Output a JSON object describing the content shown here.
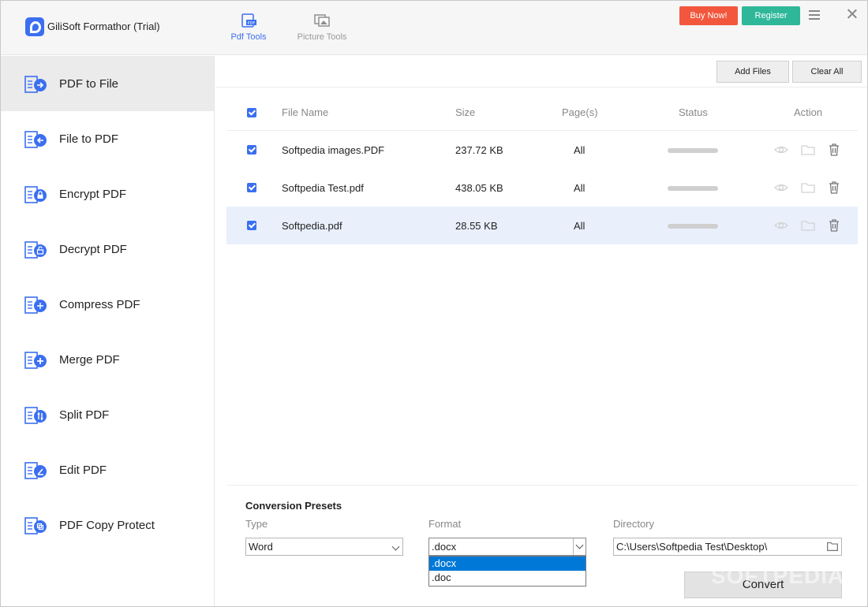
{
  "app": {
    "title": "GiliSoft Formathor (Trial)"
  },
  "header": {
    "tabs": [
      {
        "label": "Pdf Tools",
        "icon": "pdf-tools-icon"
      },
      {
        "label": "Picture Tools",
        "icon": "picture-tools-icon"
      }
    ],
    "buy_label": "Buy Now!",
    "register_label": "Register"
  },
  "colors": {
    "accent": "#3b6ff0",
    "buy": "#f2573d",
    "register": "#2fb79a",
    "selection": "#0078d7"
  },
  "sidebar": {
    "items": [
      {
        "label": "PDF to File",
        "icon": "pdf-to-file-icon",
        "active": true
      },
      {
        "label": "File to PDF",
        "icon": "file-to-pdf-icon"
      },
      {
        "label": "Encrypt PDF",
        "icon": "encrypt-pdf-icon"
      },
      {
        "label": "Decrypt PDF",
        "icon": "decrypt-pdf-icon"
      },
      {
        "label": "Compress PDF",
        "icon": "compress-pdf-icon"
      },
      {
        "label": "Merge PDF",
        "icon": "merge-pdf-icon"
      },
      {
        "label": "Split PDF",
        "icon": "split-pdf-icon"
      },
      {
        "label": "Edit PDF",
        "icon": "edit-pdf-icon"
      },
      {
        "label": "PDF Copy Protect",
        "icon": "pdf-copy-protect-icon"
      }
    ]
  },
  "toolbar": {
    "add_files": "Add Files",
    "clear_all": "Clear All"
  },
  "table": {
    "columns": [
      "File Name",
      "Size",
      "Page(s)",
      "Status",
      "Action"
    ],
    "rows": [
      {
        "name": "Softpedia images.PDF",
        "size": "237.72 KB",
        "pages": "All",
        "checked": true
      },
      {
        "name": "Softpedia Test.pdf",
        "size": "438.05 KB",
        "pages": "All",
        "checked": true
      },
      {
        "name": "Softpedia.pdf",
        "size": "28.55 KB",
        "pages": "All",
        "checked": true,
        "selected": true
      }
    ]
  },
  "presets": {
    "title": "Conversion Presets",
    "type_label": "Type",
    "type_value": "Word",
    "format_label": "Format",
    "format_value": ".docx",
    "format_options": [
      ".docx",
      ".doc"
    ],
    "directory_label": "Directory",
    "directory_value": "C:\\Users\\Softpedia Test\\Desktop\\",
    "convert_label": "Convert"
  },
  "watermark": "SOFTPEDIA"
}
